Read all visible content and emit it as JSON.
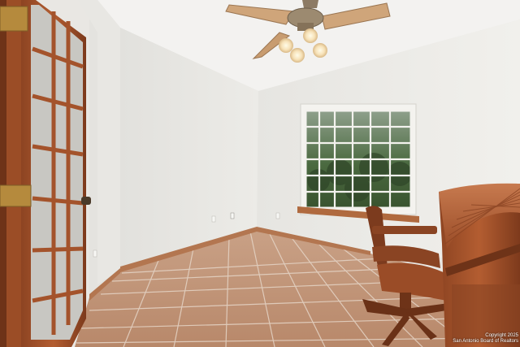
{
  "image": {
    "kind": "interior photograph",
    "objects": [
      "ceiling-fan",
      "window",
      "french-door",
      "desk-chair",
      "roll-top-desk",
      "tile-floor",
      "baseboard",
      "wall-outlet"
    ]
  },
  "watermark": {
    "line1": "Copyright 2025",
    "line2": "San Antonio Board of Realtors"
  },
  "colors": {
    "wall_left": "#ebeae7",
    "wall_back": "#eeede9",
    "ceiling": "#f4f3f1",
    "floor_tile": "#c49a7c",
    "grout": "#e2cfbf",
    "wood": "#a4532b",
    "wood_dark": "#6e3318",
    "window_frame": "#f3f2ee",
    "foliage": "#3f5a35"
  }
}
